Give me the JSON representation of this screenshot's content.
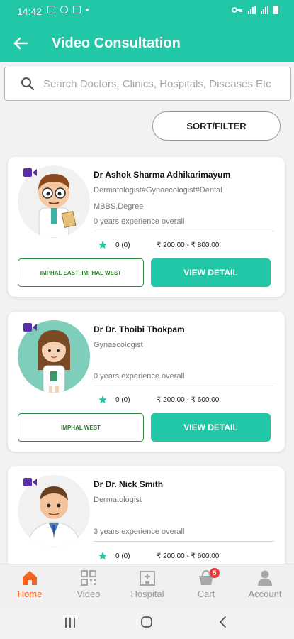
{
  "status_bar": {
    "time": "14:42"
  },
  "header": {
    "title": "Video Consultation"
  },
  "search": {
    "placeholder": "Search Doctors, Clinics, Hospitals, Diseases Etc"
  },
  "sort_filter_label": "SORT/FILTER",
  "doctors": [
    {
      "name": "Dr Ashok Sharma  Adhikarimayum",
      "specialty": "Dermatologist#Gynaecologist#Dental",
      "degree": "MBBS,Degree",
      "experience": "0 years experience overall",
      "rating": "0 (0)",
      "price": "₹ 200.00 - ₹ 800.00",
      "location": "IMPHAL EAST ,IMPHAL WEST",
      "view_label": "VIEW DETAIL"
    },
    {
      "name": "Dr Dr. Thoibi Thokpam",
      "specialty": "Gynaecologist",
      "degree": "",
      "experience": "0 years experience overall",
      "rating": "0 (0)",
      "price": "₹ 200.00 - ₹ 600.00",
      "location": "IMPHAL WEST",
      "view_label": "VIEW DETAIL"
    },
    {
      "name": "Dr Dr. Nick  Smith",
      "specialty": "Dermatologist",
      "degree": "",
      "experience": "3 years experience overall",
      "rating": "0 (0)",
      "price": "₹ 200.00 - ₹ 600.00"
    }
  ],
  "bottom_nav": [
    {
      "label": "Home",
      "icon": "home-icon",
      "active": true
    },
    {
      "label": "Video",
      "icon": "qr-video-icon"
    },
    {
      "label": "Hospital",
      "icon": "hospital-icon"
    },
    {
      "label": "Cart",
      "icon": "cart-icon",
      "badge": "5"
    },
    {
      "label": "Account",
      "icon": "account-icon"
    }
  ],
  "colors": {
    "primary": "#22c7a7",
    "active_nav": "#f26522",
    "badge": "#e53935",
    "location_border": "#2a8a3a"
  }
}
